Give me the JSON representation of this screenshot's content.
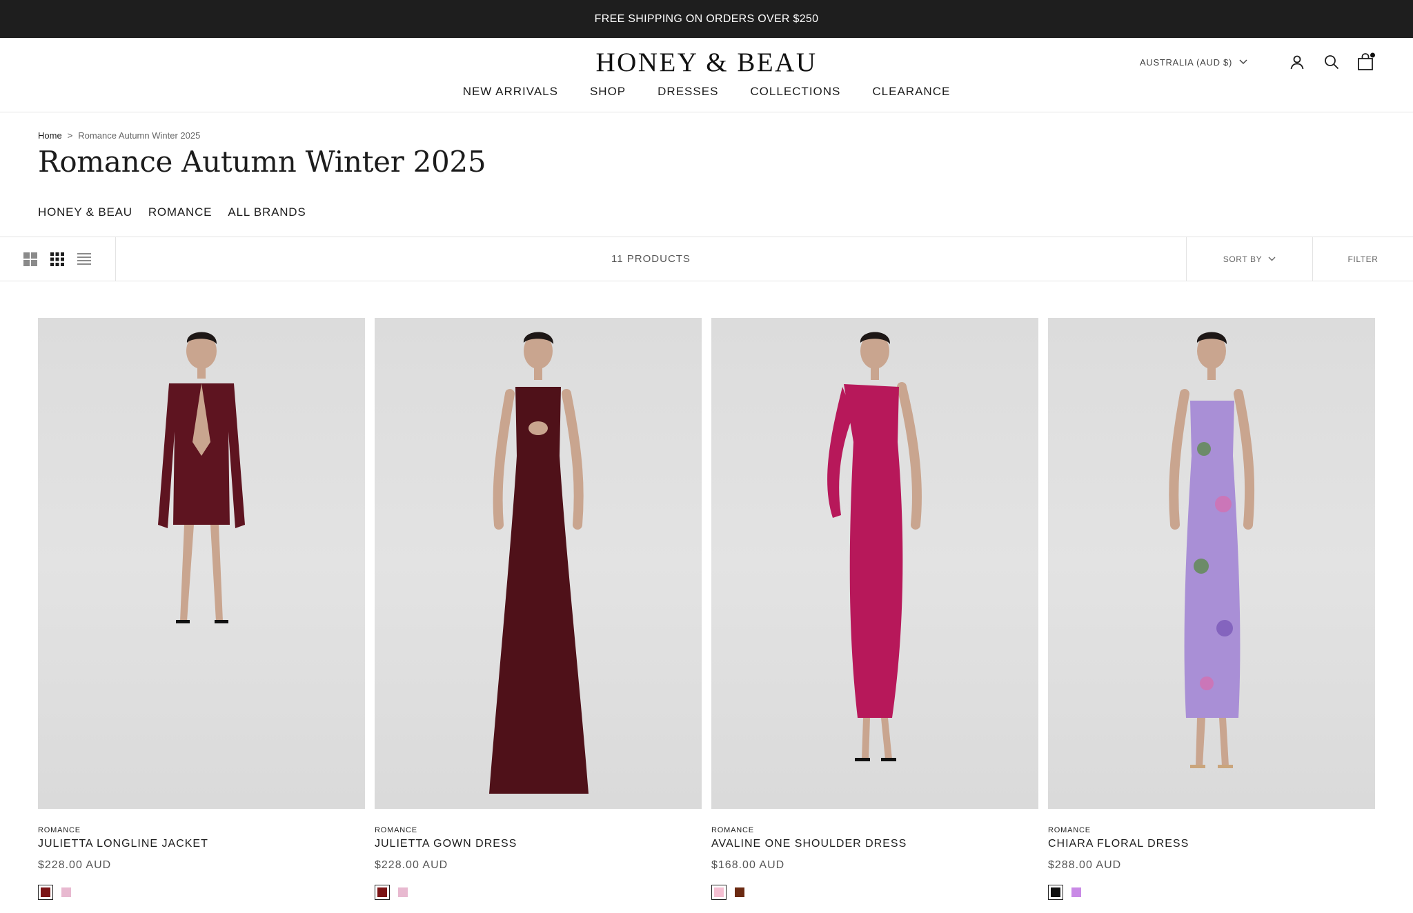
{
  "announcement": "FREE SHIPPING ON ORDERS OVER $250",
  "header": {
    "logo": "HONEY & BEAU",
    "nav": [
      "NEW ARRIVALS",
      "SHOP",
      "DRESSES",
      "COLLECTIONS",
      "CLEARANCE"
    ],
    "currency": "AUSTRALIA (AUD $)",
    "cart_has_items": true
  },
  "breadcrumb": {
    "home": "Home",
    "separator": ">",
    "current": "Romance Autumn Winter 2025"
  },
  "page_title": "Romance Autumn Winter 2025",
  "sub_nav": [
    "HONEY & BEAU",
    "ROMANCE",
    "ALL BRANDS"
  ],
  "toolbar": {
    "product_count": "11 PRODUCTS",
    "sort_label": "SORT BY",
    "filter_label": "FILTER",
    "view_modes": [
      "grid-large-icon",
      "grid-small-icon",
      "list-icon"
    ]
  },
  "products": [
    {
      "brand": "ROMANCE",
      "name": "JULIETTA LONGLINE JACKET",
      "price": "$228.00 AUD",
      "garment_color": "#5e1420",
      "swatches": [
        {
          "color": "#7b1416",
          "active": true
        },
        {
          "color": "#e8b9d0",
          "active": false
        }
      ]
    },
    {
      "brand": "ROMANCE",
      "name": "JULIETTA GOWN DRESS",
      "price": "$228.00 AUD",
      "garment_color": "#4f1119",
      "swatches": [
        {
          "color": "#7b1416",
          "active": true
        },
        {
          "color": "#e8b9d0",
          "active": false
        }
      ]
    },
    {
      "brand": "ROMANCE",
      "name": "AVALINE ONE SHOULDER DRESS",
      "price": "$168.00 AUD",
      "garment_color": "#b7185a",
      "swatches": [
        {
          "color": "#f5bfd2",
          "active": true
        },
        {
          "color": "#6b2a12",
          "active": false
        }
      ]
    },
    {
      "brand": "ROMANCE",
      "name": "CHIARA FLORAL DRESS",
      "price": "$288.00 AUD",
      "garment_color": "#a98fd6",
      "swatches": [
        {
          "color": "#111111",
          "active": true
        },
        {
          "color": "#c98ae6",
          "active": false
        }
      ]
    }
  ]
}
